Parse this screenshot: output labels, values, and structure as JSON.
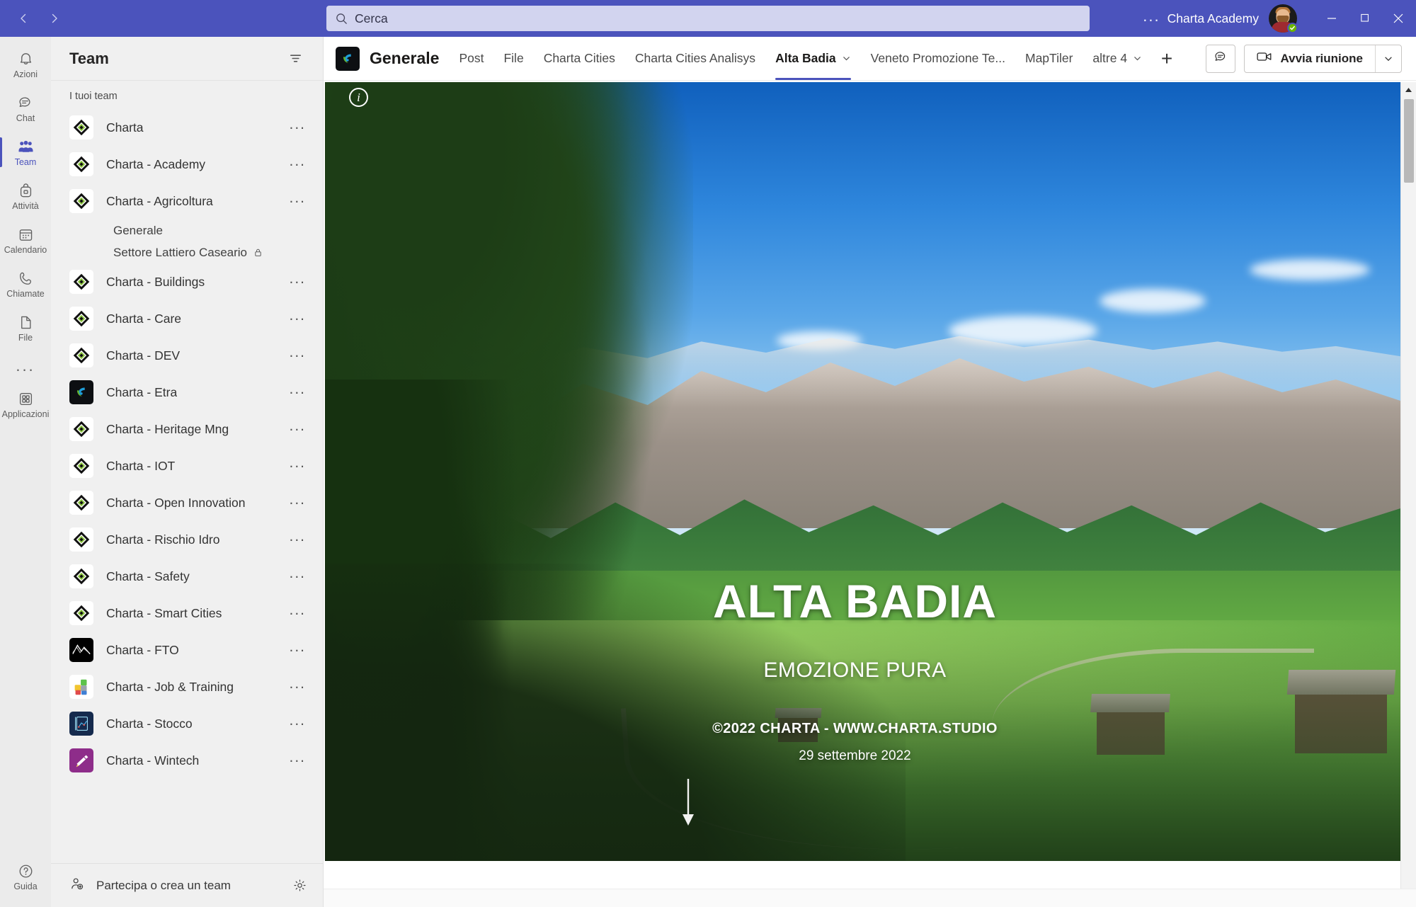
{
  "titlebar": {
    "back_label": "Indietro",
    "forward_label": "Avanti",
    "search_placeholder": "Cerca",
    "more_label": "...",
    "account_name": "Charta Academy",
    "presence": "Disponibile",
    "minimize_label": "Riduci a icona",
    "maximize_label": "Ripristina",
    "close_label": "Chiudi"
  },
  "rail": {
    "items": [
      {
        "label": "Azioni",
        "icon": "bell-icon",
        "active": false
      },
      {
        "label": "Chat",
        "icon": "chat-icon",
        "active": false
      },
      {
        "label": "Team",
        "icon": "team-icon",
        "active": true
      },
      {
        "label": "Attività",
        "icon": "backpack-icon",
        "active": false
      },
      {
        "label": "Calendario",
        "icon": "calendar-icon",
        "active": false
      },
      {
        "label": "Chiamate",
        "icon": "phone-icon",
        "active": false
      },
      {
        "label": "File",
        "icon": "file-icon",
        "active": false
      }
    ],
    "more_label": "...",
    "apps": {
      "label": "Applicazioni",
      "icon": "apps-grid-icon"
    },
    "help": {
      "label": "Guida",
      "icon": "question-circle-icon"
    }
  },
  "sidebar": {
    "title": "Team",
    "filter_label": "Filtro",
    "section_label": "I tuoi team",
    "teams": [
      {
        "name": "Charta",
        "logo": "charta-diamond-logo"
      },
      {
        "name": "Charta - Academy",
        "logo": "charta-diamond-logo"
      },
      {
        "name": "Charta - Agricoltura",
        "logo": "charta-diamond-logo",
        "channels": [
          {
            "name": "Generale",
            "private": false
          },
          {
            "name": "Settore Lattiero Caseario",
            "private": true
          }
        ]
      },
      {
        "name": "Charta - Buildings",
        "logo": "charta-diamond-logo"
      },
      {
        "name": "Charta - Care",
        "logo": "charta-diamond-logo"
      },
      {
        "name": "Charta - DEV",
        "logo": "charta-diamond-logo"
      },
      {
        "name": "Charta - Etra",
        "logo": "etra-logo"
      },
      {
        "name": "Charta - Heritage Mng",
        "logo": "charta-diamond-logo"
      },
      {
        "name": "Charta - IOT",
        "logo": "charta-diamond-logo"
      },
      {
        "name": "Charta - Open Innovation",
        "logo": "charta-diamond-logo"
      },
      {
        "name": "Charta - Rischio Idro",
        "logo": "charta-diamond-logo"
      },
      {
        "name": "Charta - Safety",
        "logo": "charta-diamond-logo"
      },
      {
        "name": "Charta - Smart Cities",
        "logo": "charta-diamond-logo"
      },
      {
        "name": "Charta - FTO",
        "logo": "fto-mountain-logo"
      },
      {
        "name": "Charta - Job & Training",
        "logo": "puzzle-logo"
      },
      {
        "name": "Charta - Stocco",
        "logo": "stocco-logo"
      },
      {
        "name": "Charta - Wintech",
        "logo": "wintech-telescope-logo"
      }
    ],
    "team_more_label": "...",
    "footer": {
      "label": "Partecipa o crea un team",
      "settings_label": "Impostazioni"
    }
  },
  "channel": {
    "logo": "etra-logo",
    "name": "Generale",
    "tabs": [
      {
        "label": "Post",
        "active": false,
        "chevron": false
      },
      {
        "label": "File",
        "active": false,
        "chevron": false
      },
      {
        "label": "Charta Cities",
        "active": false,
        "chevron": false
      },
      {
        "label": "Charta Cities Analisys",
        "active": false,
        "chevron": false
      },
      {
        "label": "Alta Badia",
        "active": true,
        "chevron": true
      },
      {
        "label": "Veneto Promozione Te...",
        "active": false,
        "chevron": false
      },
      {
        "label": "MapTiler",
        "active": false,
        "chevron": false
      },
      {
        "label": "altre 4",
        "active": false,
        "chevron": true
      }
    ],
    "add_tab_label": "+",
    "chat_button_label": "Conversazione",
    "meeting_button_label": "Avvia riunione",
    "meeting_dropdown_label": "Opzioni riunione"
  },
  "poster": {
    "info_badge": "i",
    "title": "ALTA BADIA",
    "subtitle": "EMOZIONE PURA",
    "copyright": "©2022 CHARTA - WWW.CHARTA.STUDIO",
    "date": "29 settembre 2022",
    "scroll_hint": "scorri verso il basso"
  },
  "colors": {
    "brand_purple": "#4b53bc",
    "search_bg": "#d2d4ef",
    "rail_bg": "#ebebeb",
    "sidebar_bg": "#f0f0f0",
    "presence_green": "#6bb700",
    "charta_green": "#8cc63f"
  }
}
